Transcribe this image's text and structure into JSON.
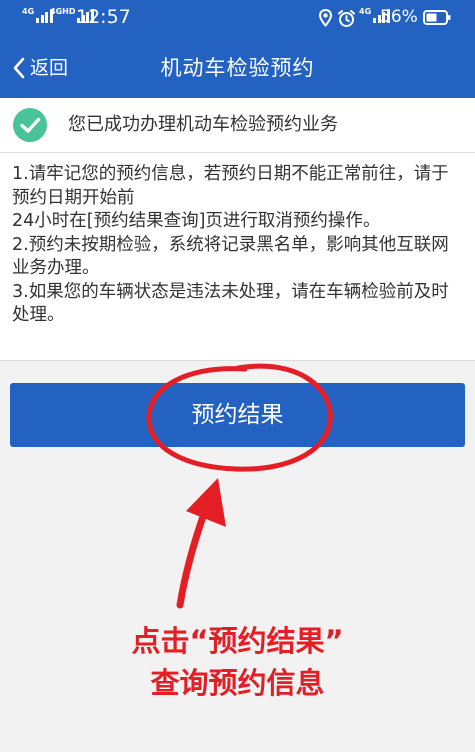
{
  "status_bar": {
    "network_1": "4G",
    "network_2": "4GHD",
    "time": "12:57",
    "network_3": "4G",
    "battery_percent": "56%",
    "icons": [
      "signal-icon",
      "location-icon",
      "alarm-icon",
      "battery-icon"
    ]
  },
  "nav": {
    "back_label": "返回",
    "title": "机动车检验预约"
  },
  "success": {
    "message": "您已成功办理机动车检验预约业务",
    "icon": "check-circle-icon",
    "icon_color": "#49c39a"
  },
  "notes": {
    "line_1": "1.请牢记您的预约信息，若预约日期不能正常前往，请于预约日期开始前",
    "line_2": "24小时在[预约结果查询]页进行取消预约操作。",
    "line_3": "2.预约未按期检验，系统将记录黑名单，影响其他互联网业务办理。",
    "line_4": "3.如果您的车辆状态是违法未处理，请在车辆检验前及时处理。"
  },
  "button": {
    "label": "预约结果"
  },
  "annotation": {
    "caption_line_1": "点击“预约结果”",
    "caption_line_2": "查询预约信息",
    "color": "#e31e24"
  },
  "colors": {
    "primary": "#2462c2",
    "page_background": "#f2f2f2",
    "text": "#333333"
  }
}
